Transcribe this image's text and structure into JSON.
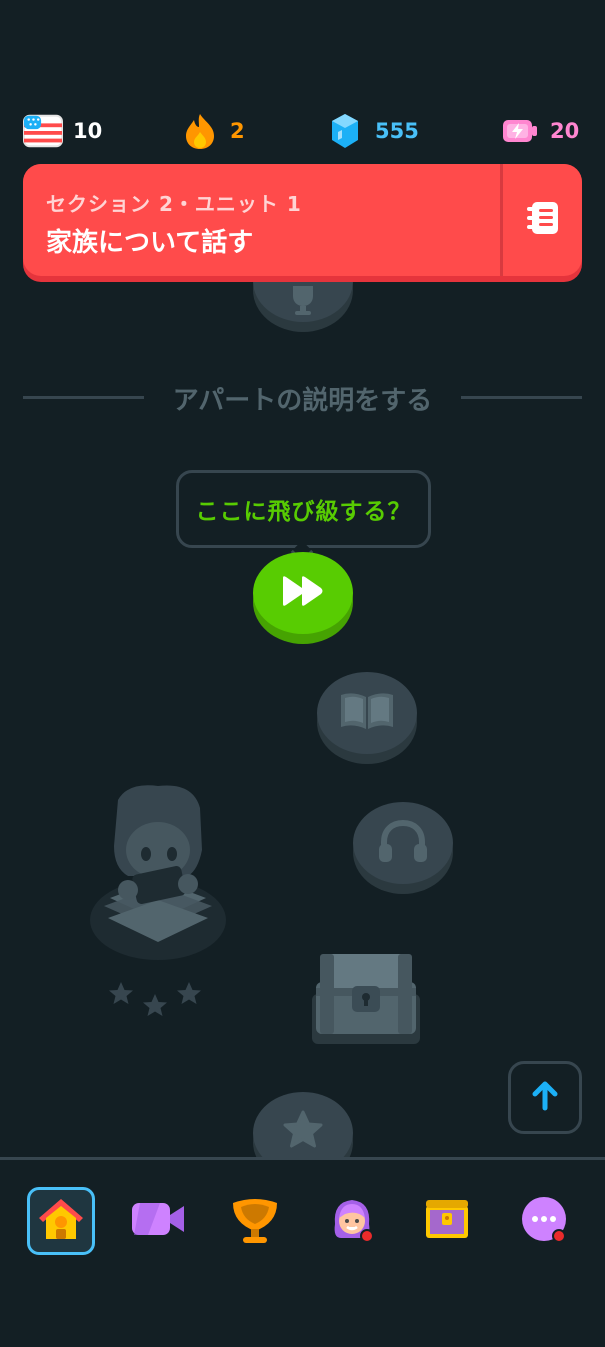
{
  "stats": {
    "language": {
      "icon": "us-flag-icon",
      "value": "10"
    },
    "streak": {
      "icon": "flame-icon",
      "value": "2",
      "color": "#ff9600"
    },
    "gems": {
      "icon": "gem-icon",
      "value": "555",
      "color": "#49c0f8"
    },
    "energy": {
      "icon": "battery-bolt-icon",
      "value": "20",
      "color": "#ff86d0"
    }
  },
  "unit_banner": {
    "subtitle": "セクション 2・ユニット 1",
    "title": "家族について話す",
    "guide_icon": "notebook-icon",
    "color": "#ff4b4b"
  },
  "section_divider": {
    "title": "アパートの説明をする"
  },
  "jump_tooltip": {
    "text": "ここに飛び級する？",
    "color": "#58cc02"
  },
  "path_nodes": [
    {
      "icon": "trophy-icon",
      "state": "locked"
    },
    {
      "icon": "fast-forward-icon",
      "state": "active"
    },
    {
      "icon": "book-icon",
      "state": "locked"
    },
    {
      "icon": "headphones-icon",
      "state": "locked"
    },
    {
      "icon": "character-reading-icon",
      "state": "locked"
    },
    {
      "icon": "treasure-chest-icon",
      "state": "locked"
    },
    {
      "icon": "star-icon",
      "state": "locked"
    }
  ],
  "scroll_up": {
    "icon": "arrow-up-icon"
  },
  "tabs": [
    {
      "icon": "home-icon",
      "active": true
    },
    {
      "icon": "video-camera-icon",
      "active": false
    },
    {
      "icon": "league-trophy-icon",
      "active": false
    },
    {
      "icon": "profile-avatar-icon",
      "active": false,
      "badge": true
    },
    {
      "icon": "treasure-chest-tab-icon",
      "active": false
    },
    {
      "icon": "more-icon",
      "active": false,
      "badge": true
    }
  ]
}
